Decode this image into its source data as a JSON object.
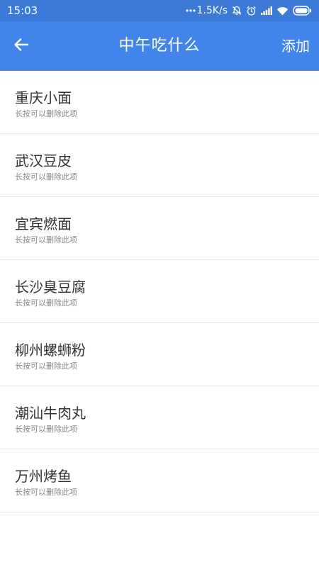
{
  "status_bar": {
    "time": "15:03",
    "network_speed": "1.5K/s",
    "icons": [
      "dots-icon",
      "mute-bell-icon",
      "alarm-icon",
      "signal-icon",
      "wifi-icon",
      "battery-icon"
    ]
  },
  "app_bar": {
    "title": "中午吃什么",
    "add_label": "添加",
    "back_icon": "arrow-left-icon"
  },
  "colors": {
    "status_bar": "#3d7ad8",
    "app_bar": "#4285ea",
    "title_text": "#333333",
    "hint_text": "#888888",
    "divider": "#e6e6e6"
  },
  "items": [
    {
      "title": "重庆小面",
      "hint": "长按可以删除此项"
    },
    {
      "title": "武汉豆皮",
      "hint": "长按可以删除此项"
    },
    {
      "title": "宜宾燃面",
      "hint": "长按可以删除此项"
    },
    {
      "title": "长沙臭豆腐",
      "hint": "长按可以删除此项"
    },
    {
      "title": "柳州螺蛳粉",
      "hint": "长按可以删除此项"
    },
    {
      "title": "潮汕牛肉丸",
      "hint": "长按可以删除此项"
    },
    {
      "title": "万州烤鱼",
      "hint": "长按可以删除此项"
    }
  ]
}
